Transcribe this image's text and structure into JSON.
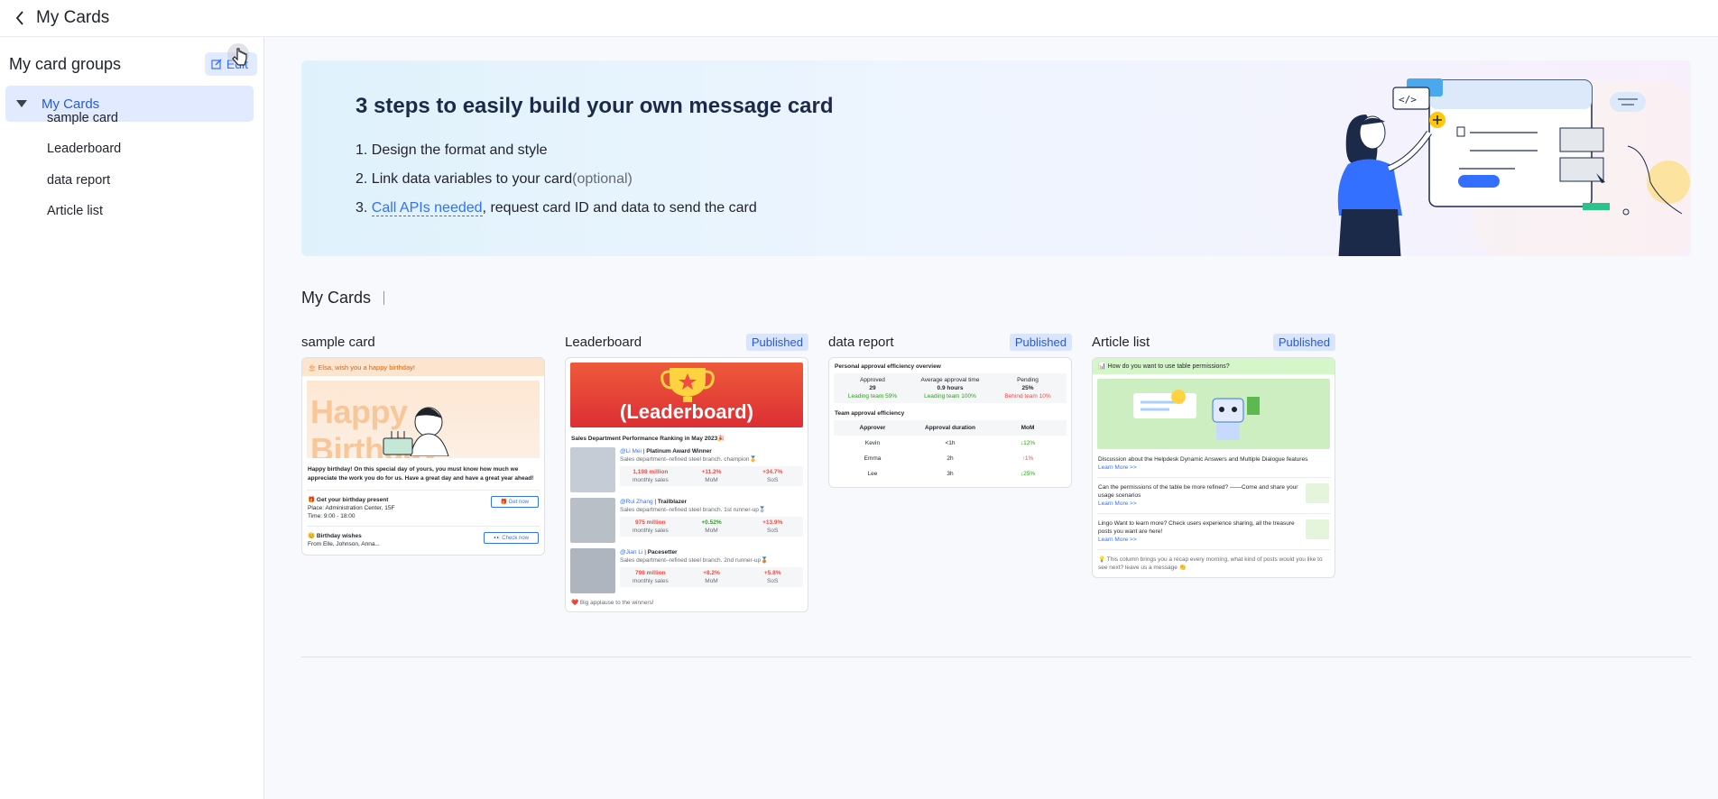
{
  "topbar": {
    "title": "My Cards"
  },
  "sidebar": {
    "heading": "My card groups",
    "edit_label": "Edit",
    "group_label": "My Cards",
    "items": [
      {
        "label": "sample card"
      },
      {
        "label": "Leaderboard"
      },
      {
        "label": "data report"
      },
      {
        "label": "Article list"
      }
    ]
  },
  "banner": {
    "title": "3 steps to easily build your own message card",
    "step1": "1. Design the format and style",
    "step2": "2. Link data variables to your card",
    "step2_optional": "(optional)",
    "step3_prefix": "3. ",
    "step3_link": "Call APIs needed",
    "step3_suffix": ", request card ID and data to send the card"
  },
  "section": {
    "title": "My Cards"
  },
  "cards": {
    "sample": {
      "name": "sample card",
      "header": "🎂 Elsa, wish you a happy birthday!",
      "hero_text": "Happy Birthday",
      "body": "Happy birthday! On this special day of yours, you must know how much we appreciate the work you do for us. Have a great day and have a great year ahead!",
      "present_title": "🎁 Get your birthday present",
      "present_place": "Place: Administration Center, 15F",
      "present_time": "Time: 9:00 - 18:00",
      "present_btn": "🎁 Get now",
      "wishes_title": "😊 Birthday wishes",
      "wishes_from": "From Elle, Johnson, Anna...",
      "wishes_btn": "👀 Check now"
    },
    "leaderboard": {
      "name": "Leaderboard",
      "badge": "Published",
      "banner_text": "(Leaderboard)",
      "caption": "Sales Department Performance Ranking in May 2023🎉",
      "rows": [
        {
          "handle": "@Li Mei",
          "title": "Platinum Award Winner",
          "desc": "Sales department–refined steel branch. champion🥇",
          "sales": "1,198 million",
          "mom": "+11.2%",
          "sos": "+34.7%"
        },
        {
          "handle": "@Rui Zhang",
          "title": "Trailblazer",
          "desc": "Sales department–refined steel branch. 1st runner-up🥈",
          "sales": "975 million",
          "mom": "+0.52%",
          "sos": "+13.9%"
        },
        {
          "handle": "@Jian Li",
          "title": "Pacesetter",
          "desc": "Sales department–refined steel branch. 2nd runner-up🥉",
          "sales": "798 million",
          "mom": "+8.2%",
          "sos": "+5.8%"
        }
      ],
      "sales_label": "monthly sales",
      "mom_label": "MoM",
      "sos_label": "SoS",
      "footer": "❤️ Big applause to the winners!"
    },
    "report": {
      "name": "data report",
      "badge": "Published",
      "personal_title": "Personal approval efficiency overview",
      "metrics": [
        {
          "label": "Approved",
          "value": "29",
          "note": "Leading team 59%"
        },
        {
          "label": "Average approval time",
          "value": "0.9 hours",
          "note": "Leading team 100%"
        },
        {
          "label": "Pending",
          "value": "25%",
          "note": "Behind team 10%"
        }
      ],
      "team_title": "Team approval efficiency",
      "columns": [
        "Approver",
        "Approval duration",
        "MoM"
      ],
      "rows": [
        [
          "Kevin",
          "<1h",
          "↓12%"
        ],
        [
          "Emma",
          "2h",
          "↑1%"
        ],
        [
          "Lee",
          "3h",
          "↓25%"
        ]
      ]
    },
    "articles": {
      "name": "Article list",
      "badge": "Published",
      "header": "📊 How do you want to use table permissions?",
      "item1": "Discussion about the Helpdesk Dynamic Answers and Multiple Dialogue features",
      "item2": "Can the permissions of the table be more refined? ——Come and share your usage scenarios",
      "item3": "Lingo Want to learn more? Check users experience sharing, all the treasure posts you want are here!",
      "learn_more": "Learn More >>",
      "footer": "💡 This column brings you a recap every morning, what kind of posts would you like to see next? leave us a message 👏"
    }
  }
}
